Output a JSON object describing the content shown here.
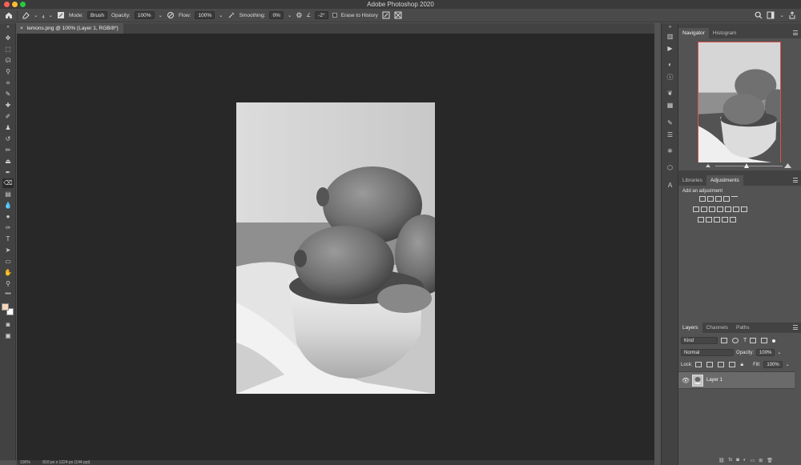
{
  "app": {
    "title": "Adobe Photoshop 2020"
  },
  "options_bar": {
    "brush_size": "4",
    "mode_label": "Mode:",
    "mode_value": "Brush",
    "opacity_label": "Opacity:",
    "opacity_value": "100%",
    "flow_label": "Flow:",
    "flow_value": "100%",
    "smoothing_label": "Smoothing:",
    "smoothing_value": "0%",
    "angle_value": "-2°",
    "erase_history_label": "Erase to History"
  },
  "document": {
    "tab_title": "lemons.png @ 100% (Layer 1, RGB/8*)",
    "close_glyph": "×",
    "zoom": "100%",
    "dimensions": "810 px x 1224 px (144 ppi)"
  },
  "navigator": {
    "tabs": [
      "Navigator",
      "Histogram"
    ],
    "zoom": "100%"
  },
  "adjustments": {
    "tabs": [
      "Libraries",
      "Adjustments"
    ],
    "add_label": "Add an adjustment"
  },
  "layers": {
    "tabs": [
      "Layers",
      "Channels",
      "Paths"
    ],
    "filter_value": "Kind",
    "blend_mode": "Normal",
    "opacity_label": "Opacity:",
    "opacity_value": "100%",
    "lock_label": "Lock:",
    "fill_label": "Fill:",
    "fill_value": "100%",
    "items": [
      {
        "name": "Layer 1",
        "visible": true
      }
    ]
  },
  "colors": {
    "foreground": "#f4d6bd",
    "background": "#ffffff",
    "accent_red": "#d9534f"
  }
}
